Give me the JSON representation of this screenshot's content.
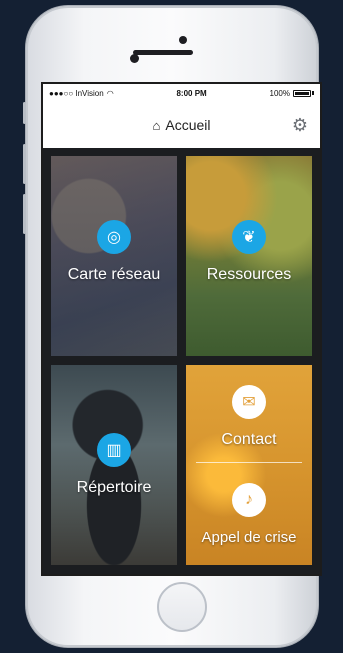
{
  "status_bar": {
    "carrier": "●●●○○ InVision",
    "time": "8:00 PM",
    "battery": "100%"
  },
  "header": {
    "title": "Accueil"
  },
  "tiles": [
    {
      "label": "Carte réseau",
      "icon": "network-icon"
    },
    {
      "label": "Ressources",
      "icon": "tree-icon"
    },
    {
      "label": "Répertoire",
      "icon": "book-icon"
    },
    {
      "label": "Contact",
      "icon": "chat-icon"
    },
    {
      "label": "Appel de crise",
      "icon": "bell-icon"
    }
  ],
  "colors": {
    "accent_blue": "#1ba6e5",
    "accent_orange": "#e1a33a",
    "grid_background": "#1b1d20"
  }
}
